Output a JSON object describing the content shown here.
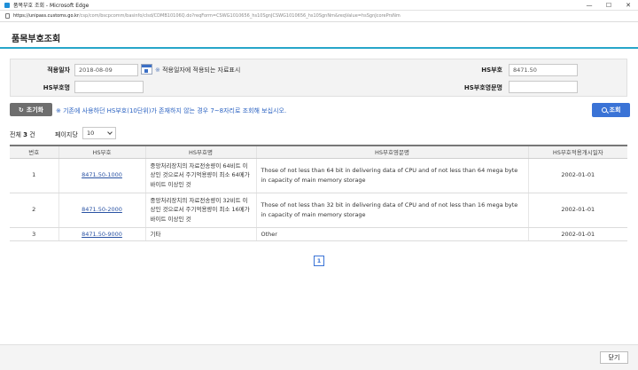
{
  "window": {
    "title": "품목부호 조회 - Microsoft Edge",
    "url_host": "https://unipass.customs.go.kr",
    "url_path": "/csp/com/bscpcomm/basinfo/clsd/CDMB10106Q.do?reqForm=CSWG1010656_hs10SgnJCSWG1010656_hs10SgnNm&reqValue=hsSgnJcorePrsNm"
  },
  "page": {
    "title": "품목부호조회"
  },
  "search": {
    "apply_date_label": "적용일자",
    "apply_date_value": "2018-08-09",
    "apply_note_mark": "※",
    "apply_note": "적용일자에 적용되는 자료표시",
    "hs_code_label": "HS부호",
    "hs_code_value": "8471.50",
    "hs_name_label": "HS부호명",
    "hs_name_value": "",
    "hs_eng_name_label": "HS부호영문명",
    "hs_eng_name_value": ""
  },
  "actions": {
    "reset_label": "초기화",
    "hint": "※ 기존에 사용하던 HS부호(10단위)가 존재하지 않는 경우 7~8자리로 조회해 보십시오.",
    "search_label": "조회"
  },
  "results": {
    "total_prefix": "전체",
    "total_count": "3",
    "total_suffix": "건",
    "per_page_label": "페이지당",
    "per_page_value": "10",
    "columns": [
      "번호",
      "HS부호",
      "HS부호명",
      "HS부호영문명",
      "HS부호적용개시일자"
    ],
    "rows": [
      {
        "no": "1",
        "code": "8471.50-1000",
        "name": "중앙처리장치의 자료전송량이 64비트 이상인 것으로서 주기억용량이 최소 64메가바이트 이상인 것",
        "eng": "Those of not less than 64 bit in delivering data of CPU and of not less than 64 mega byte in capacity of main memory storage",
        "date": "2002-01-01"
      },
      {
        "no": "2",
        "code": "8471.50-2000",
        "name": "중앙처리장치의 자료전송량이 32비트 이상인 것으로서 주기억용량이 최소 16메가바이트 이상인 것",
        "eng": "Those of not less than 32 bit in delivering data of CPU and of not less than 16 mega byte in capacity of main memory storage",
        "date": "2002-01-01"
      },
      {
        "no": "3",
        "code": "8471.50-9000",
        "name": "기타",
        "eng": "Other",
        "date": "2002-01-01"
      }
    ]
  },
  "pagination": {
    "current_page": "1"
  },
  "footer": {
    "close_label": "닫기"
  },
  "colors": {
    "accent": "#3a73d6",
    "header_rule": "#27a6c9",
    "reset_bg": "#6e6e6e",
    "hint": "#2c63c2"
  },
  "icons": [
    "app-icon",
    "lock-icon",
    "calendar-icon",
    "refresh-icon",
    "search-icon",
    "chevron-down-icon"
  ]
}
